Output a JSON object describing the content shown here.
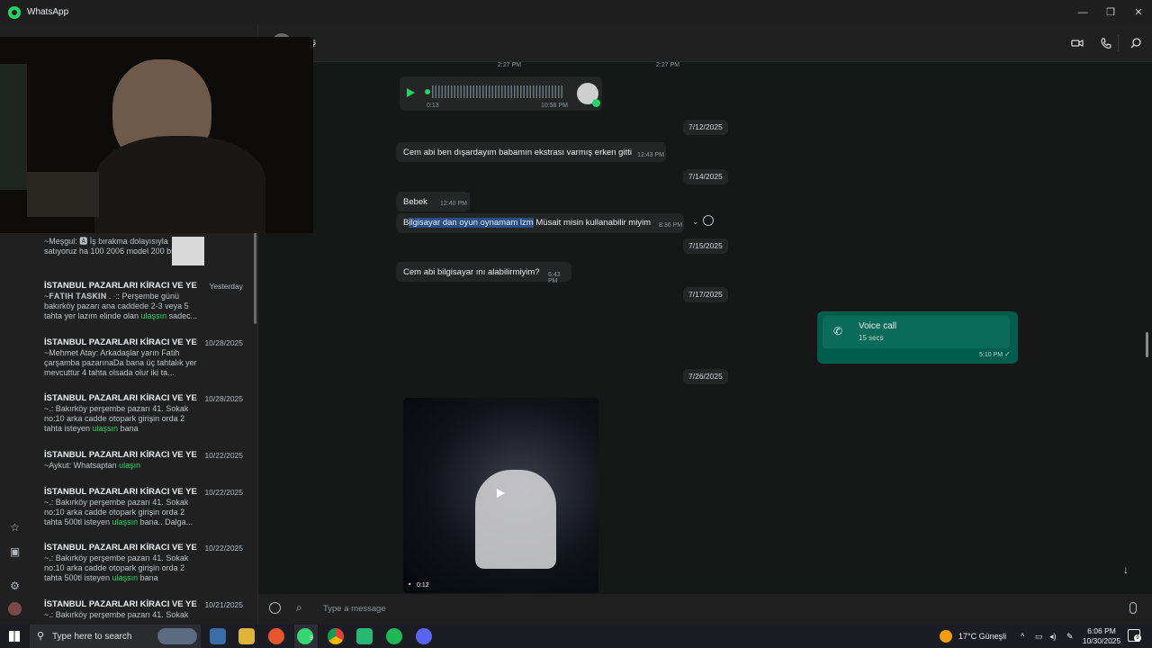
{
  "app": {
    "title": "WhatsApp"
  },
  "window_controls": {
    "minimize": "—",
    "restore": "❐",
    "close": "✕"
  },
  "chat_header": {
    "name_fragment": "ş"
  },
  "sidebar_chats": [
    {
      "name": "",
      "date": "",
      "preview_pre": "~Meşgul: 🅰 İş bırakma dolayısıyla satıyoruz ha 100 2006  model 200 bind...",
      "green": "",
      "preview_post": "",
      "has_thumb": true
    },
    {
      "name": "İSTANBUL PAZARLARI KİRACI VE YER S...",
      "date": "Yesterday",
      "preview_pre": "~𝐅𝐀𝐓𝐈𝐇 𝐓𝐀𝐒𝐊𝐈𝐍 . ⁖: Perşembe günü bakırköy pazarı ana caddede 2-3 veya 5 tahta yer lazım elinde olan ",
      "green": "ulaşsın",
      "preview_post": " sadec..."
    },
    {
      "name": "İSTANBUL PAZARLARI KİRACI VE YER...",
      "date": "10/28/2025",
      "preview_pre": "~Mehmet Atay: Arkadaşlar yarın Fatih çarşamba pazarınaDa bana üç tahtalık yer mevcuttur 4 tahta olsada olur iki ta...",
      "green": "",
      "preview_post": ""
    },
    {
      "name": "İSTANBUL PAZARLARI KİRACI VE YER...",
      "date": "10/28/2025",
      "preview_pre": "~.: Bakırköy perşembe pazarı 41. Sokak no:10 arka cadde otopark girişin orda 2 tahta isteyen ",
      "green": "ulaşsın",
      "preview_post": " bana"
    },
    {
      "name": "İSTANBUL PAZARLARI KİRACI VE YER...",
      "date": "10/22/2025",
      "preview_pre": "~Aykut: Whatsaptan ",
      "green": "ulaşın",
      "preview_post": ""
    },
    {
      "name": "İSTANBUL PAZARLARI KİRACI VE YER...",
      "date": "10/22/2025",
      "preview_pre": "~.: Bakırköy perşembe pazarı 41. Sokak no:10 arka cadde otopark girişin orda 2 tahta 500tl isteyen ",
      "green": "ulaşsın",
      "preview_post": " bana.. Dalga..."
    },
    {
      "name": "İSTANBUL PAZARLARI KİRACI VE YER...",
      "date": "10/22/2025",
      "preview_pre": "~.: Bakırköy perşembe pazarı 41. Sokak no:10 arka cadde otopark girişin orda 2 tahta 500tl isteyen ",
      "green": "ulaşsın",
      "preview_post": " bana"
    },
    {
      "name": "İSTANBUL PAZARLARI KİRACI VE YER...",
      "date": "10/21/2025",
      "preview_pre": "~.: Bakırköy perşembe pazarı 41. Sokak",
      "green": "",
      "preview_post": ""
    }
  ],
  "messages": {
    "top_times": [
      "2:27 PM",
      "2:27 PM"
    ],
    "voice": {
      "duration": "0:13",
      "time": "10:58 PM"
    },
    "date1": "7/12/2025",
    "msg1": {
      "text": "Cem abi ben dışardayım babamın ekstrası varmış erken gitti",
      "time": "12:43 PM"
    },
    "date2": "7/14/2025",
    "msg2": {
      "text": "Bebek",
      "time": "12:40 PM"
    },
    "msg3": {
      "first_char": "B",
      "selected": "ilgisayar dan oyun oynamam lzm",
      "rest": " Müsait misin kullanabilir miyim",
      "time": "8:36 PM"
    },
    "date3": "7/15/2025",
    "msg4": {
      "text": "Cem abi bilgisayar ını alabilirmiyim?",
      "time": "6:43 PM"
    },
    "date4": "7/17/2025",
    "call": {
      "title": "Voice call",
      "duration": "15 secs",
      "time": "5:10 PM"
    },
    "date5": "7/26/2025",
    "video": {
      "duration": "0:12"
    }
  },
  "composer": {
    "placeholder": "Type a message"
  },
  "taskbar": {
    "search_placeholder": "Type here to search",
    "weather": "17°C  Güneşli",
    "time": "6:06 PM",
    "date": "10/30/2025",
    "notification_count": "9",
    "whatsapp_badge": "9"
  },
  "colors": {
    "accent": "#25d366",
    "outgoing": "#005c4b",
    "incoming": "#242626",
    "selection": "#2a4f87"
  }
}
